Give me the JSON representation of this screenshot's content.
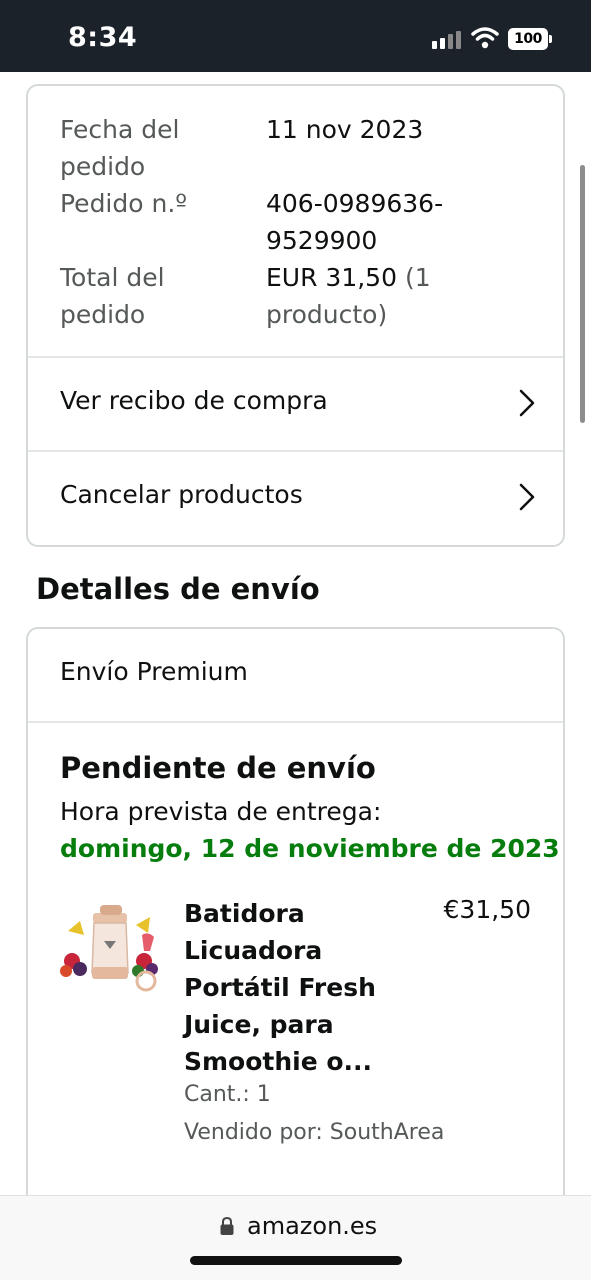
{
  "status_bar": {
    "time": "8:34",
    "battery": "100"
  },
  "order_summary": {
    "date_label": "Fecha del pedido",
    "date_value": "11 nov 2023",
    "number_label": "Pedido n.º",
    "number_value": "406-0989636-9529900",
    "total_label": "Total del pedido",
    "total_value": "EUR 31,50",
    "total_count": "(1 producto)",
    "view_receipt_label": "Ver recibo de compra",
    "cancel_label": "Cancelar productos"
  },
  "shipping": {
    "heading": "Detalles de envío",
    "type": "Envío Premium",
    "status": "Pendiente de envío",
    "eta_label": "Hora prevista de entrega:",
    "eta_date": "domingo, 12 de noviembre de 2023",
    "eta_color": "#067d0d",
    "product": {
      "title": "Batidora Licuadora Portátil Fresh Juice, para Smoothie o...",
      "price": "€31,50",
      "qty": "Cant.: 1",
      "seller": "Vendido por: SouthArea"
    }
  },
  "browser": {
    "url": "amazon.es",
    "lock_icon": "lock-icon"
  }
}
